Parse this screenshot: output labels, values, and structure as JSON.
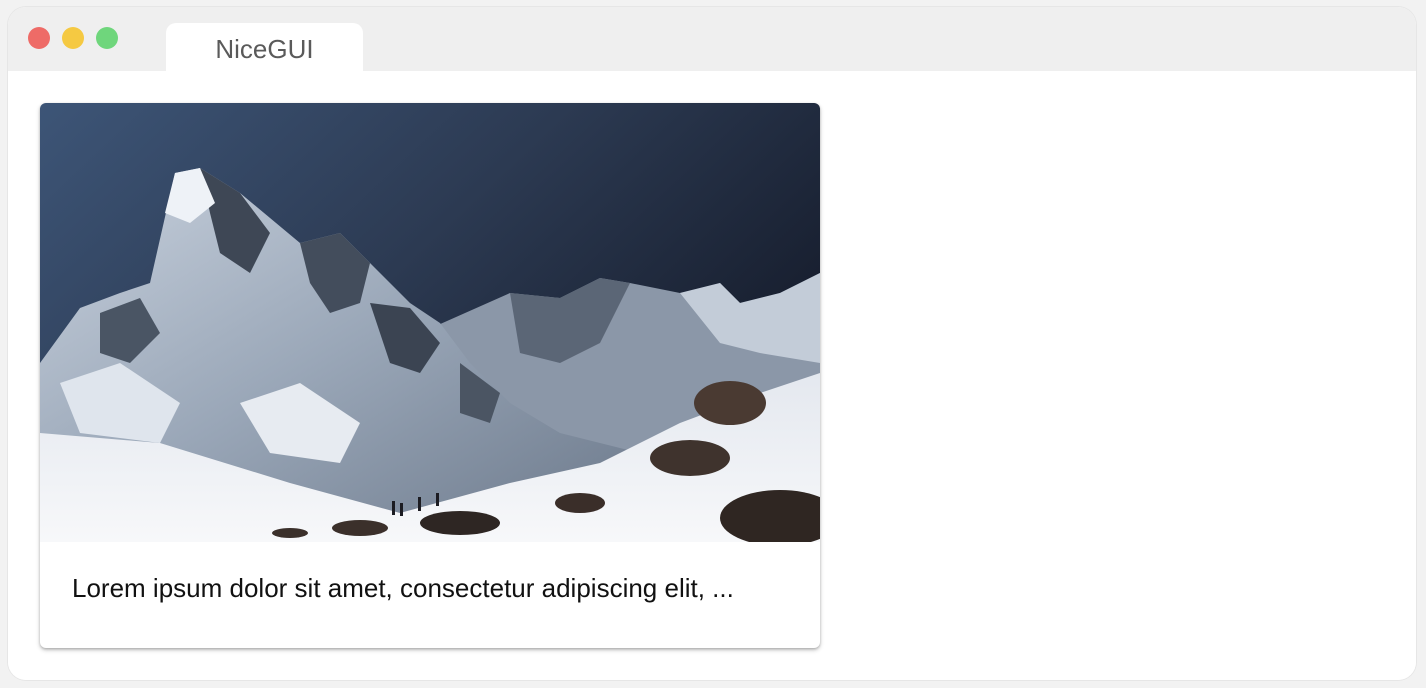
{
  "window": {
    "tab_title": "NiceGUI"
  },
  "card": {
    "image_alt": "snowy mountain range under dark sky",
    "text": "Lorem ipsum dolor sit amet, consectetur adipiscing elit, ..."
  },
  "colors": {
    "close": "#ee6b67",
    "minimize": "#f5c942",
    "maximize": "#6fd67c",
    "titlebar": "#efefef"
  }
}
